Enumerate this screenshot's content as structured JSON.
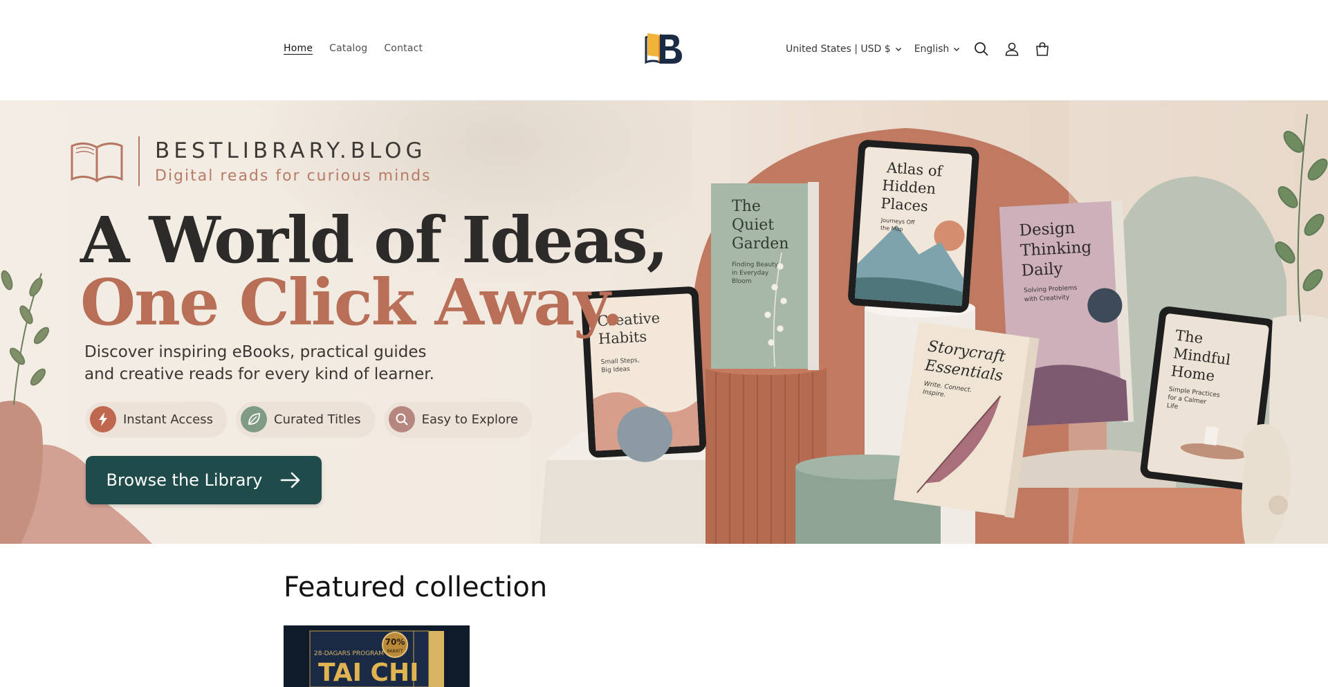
{
  "header": {
    "nav": [
      {
        "label": "Home",
        "active": true
      },
      {
        "label": "Catalog",
        "active": false
      },
      {
        "label": "Contact",
        "active": false
      }
    ],
    "country_selector": "United States | USD $",
    "language_selector": "English",
    "icons": [
      "search-icon",
      "account-icon",
      "cart-icon"
    ]
  },
  "hero": {
    "brand_name": "BESTLIBRARY.BLOG",
    "brand_tagline": "Digital reads for curious minds",
    "headline_line1": "A World of Ideas,",
    "headline_line2": "One Click Away.",
    "description": "Discover inspiring eBooks, practical guides and creative reads for every kind of learner.",
    "badges": [
      {
        "label": "Instant Access",
        "icon": "bolt-icon",
        "color": "#c0674f"
      },
      {
        "label": "Curated Titles",
        "icon": "leaf-icon",
        "color": "#7f9a85"
      },
      {
        "label": "Easy to Explore",
        "icon": "search-icon",
        "color": "#b6877f"
      }
    ],
    "cta_label": "Browse the Library",
    "books": [
      {
        "title": "Creative Habits",
        "subtitle": "Small Steps, Big Ideas"
      },
      {
        "title": "The Quiet Garden",
        "subtitle": "Finding Beauty in Everyday Bloom"
      },
      {
        "title": "Atlas of Hidden Places",
        "subtitle": "Journeys Off the Map"
      },
      {
        "title": "Storycraft Essentials",
        "subtitle": "Write. Connect. Inspire."
      },
      {
        "title": "Design Thinking Daily",
        "subtitle": "Solving Problems with Creativity"
      },
      {
        "title": "The Mindful Home",
        "subtitle": "Simple Practices for a Calmer Life"
      }
    ]
  },
  "featured": {
    "title": "Featured collection",
    "product_badge": "70%",
    "product_badge_sub": "RABATT",
    "product_kicker": "28-DAGARS PROGRAM",
    "product_title": "TAI CHI"
  },
  "colors": {
    "accent_terracotta": "#b96f57",
    "cta_green": "#1f4c4a",
    "sage": "#8fa394"
  }
}
